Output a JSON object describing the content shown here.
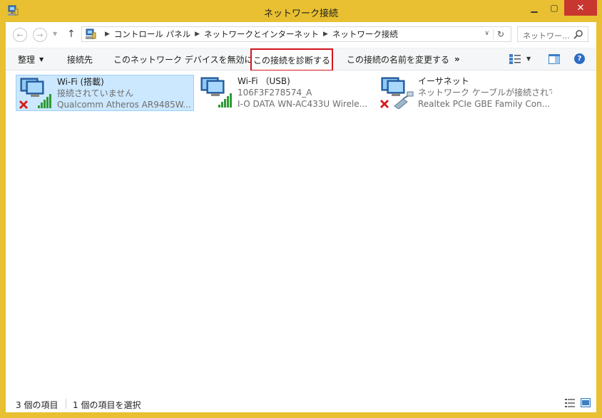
{
  "window": {
    "title": "ネットワーク接続"
  },
  "nav": {
    "breadcrumbs": [
      "コントロール パネル",
      "ネットワークとインターネット",
      "ネットワーク接続"
    ],
    "search_placeholder": "ネットワー…"
  },
  "toolbar": {
    "organize": "整理",
    "connect": "接続先",
    "disable": "このネットワーク デバイスを無効にする",
    "diagnose": "この接続を診断する",
    "rename": "この接続の名前を変更する",
    "more": "»"
  },
  "connections": [
    {
      "name": "Wi-Fi (搭載)",
      "status": "接続されていません",
      "device": "Qualcomm Atheros AR9485W...",
      "type": "wifi",
      "disconnected": true,
      "selected": true
    },
    {
      "name": "Wi-Fi （USB)",
      "status": "106F3F278574_A",
      "device": "I-O DATA WN-AC433U Wirele...",
      "type": "wifi",
      "disconnected": false,
      "selected": false
    },
    {
      "name": "イーサネット",
      "status": "ネットワーク ケーブルが接続されていま...",
      "device": "Realtek PCIe GBE Family Con...",
      "type": "ethernet",
      "disconnected": true,
      "selected": false
    }
  ],
  "status": {
    "item_count": "3 個の項目",
    "selected_count": "1 個の項目を選択"
  },
  "colors": {
    "frame": "#e8c032",
    "selection_bg": "#cce8ff",
    "selection_border": "#99d1ff",
    "highlight_box": "#d3161c",
    "close_button": "#c7372f"
  }
}
